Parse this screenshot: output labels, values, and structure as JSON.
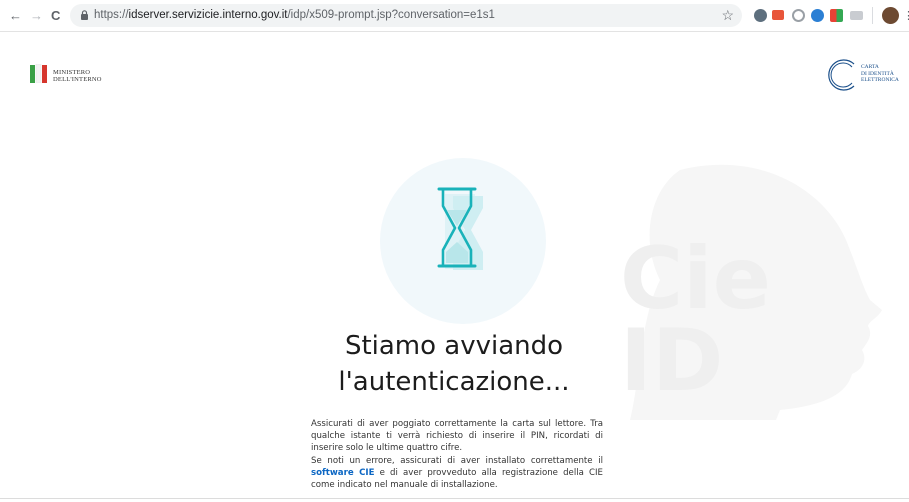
{
  "browser": {
    "back_glyph": "←",
    "forward_glyph": "→",
    "reload_glyph": "C",
    "url_prefix": "https://",
    "url_host": "idserver.servizicie.interno.gov.it",
    "url_path": "/idp/x509-prompt.jsp?conversation=e1s1",
    "bookmark_icon": "☆"
  },
  "header": {
    "ministry_line1": "MINISTERO",
    "ministry_line2": "DELL'INTERNO",
    "cie_line1": "CARTA",
    "cie_line2": "DI IDENTITÀ",
    "cie_line3": "ELETTRONICA"
  },
  "main": {
    "title_line1": "Stiamo avviando",
    "title_line2": "l'autenticazione...",
    "para1": "Assicurati di aver poggiato correttamente la carta sul lettore. Tra qualche istante ti verrà richiesto di inserire il PIN, ricordati di inserire solo le ultime quattro cifre.",
    "para2_before": "Se noti un errore, assicurati di aver installato correttamente il ",
    "para2_link": "software CIE",
    "para2_after": " e di aver provveduto alla registrazione della CIE come indicato nel manuale di installazione."
  },
  "watermark": {
    "line1": "Cie",
    "line2": "ID"
  },
  "colors": {
    "accent_teal": "#19b2b9",
    "link_blue": "#0b66c3",
    "cie_blue": "#1a4f8a"
  }
}
